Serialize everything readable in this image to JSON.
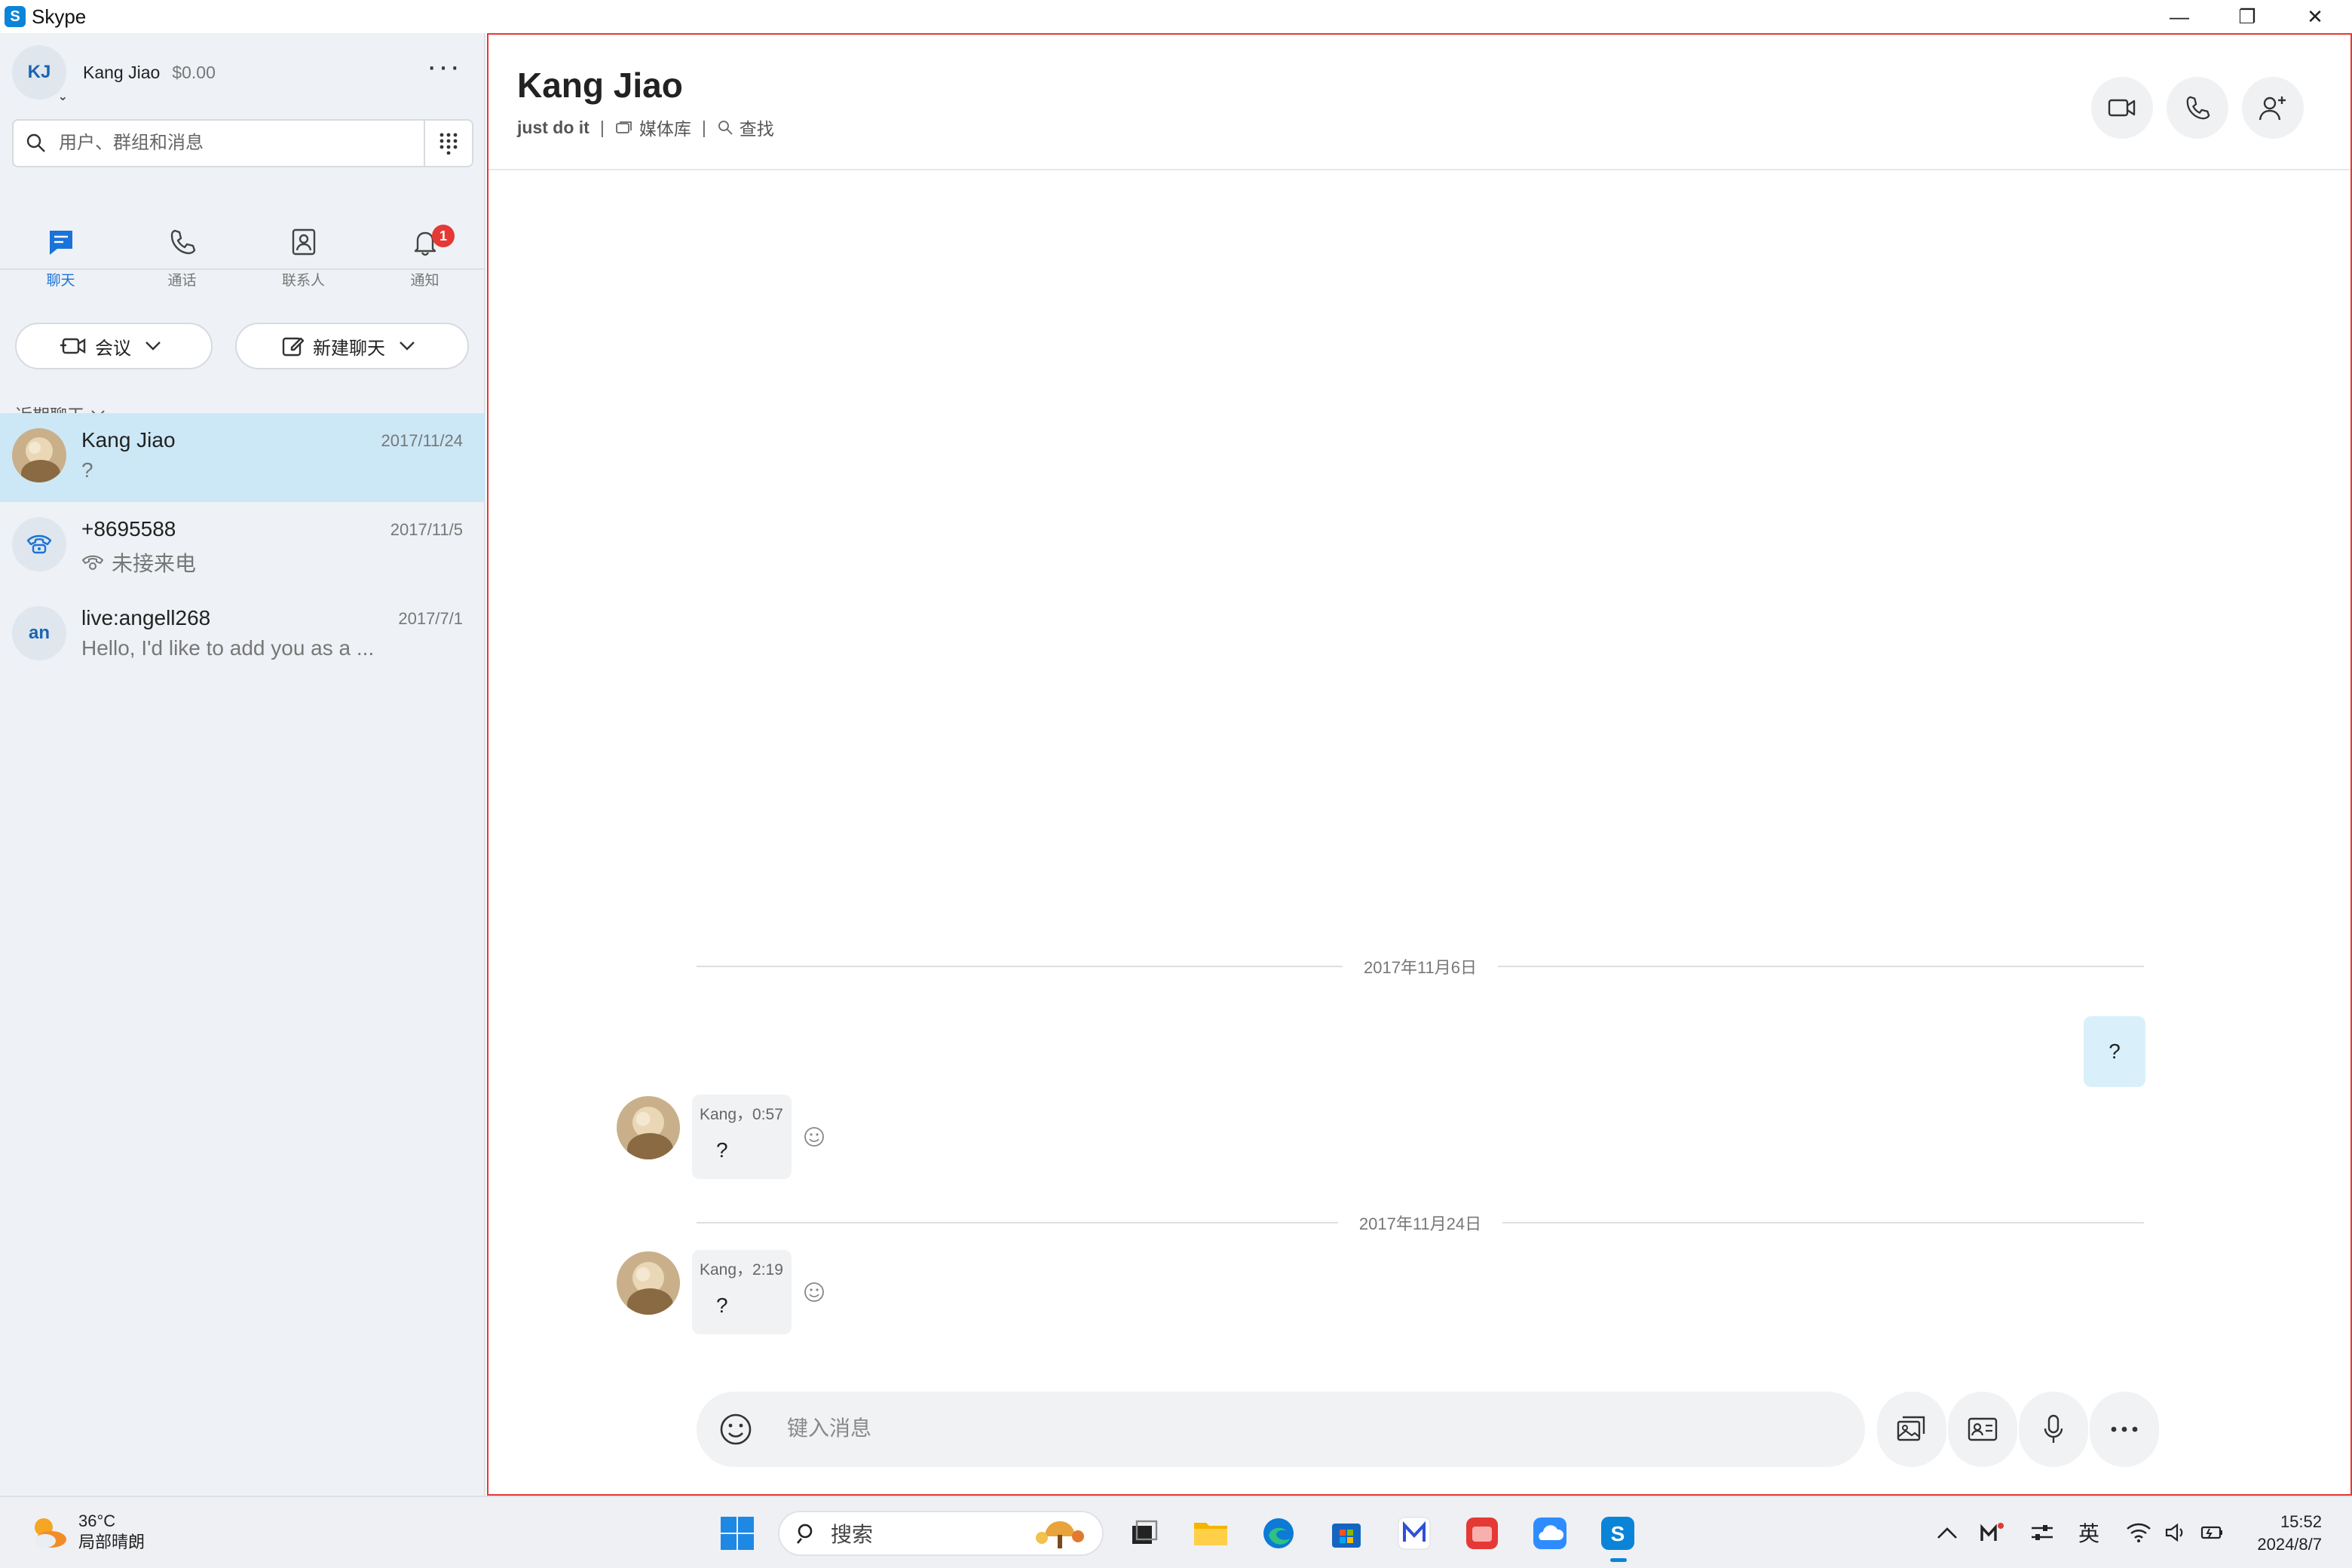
{
  "window": {
    "title": "Skype",
    "minimize_glyph": "—",
    "restore_glyph": "❐",
    "close_glyph": "✕"
  },
  "profile": {
    "initials": "KJ",
    "name": "Kang Jiao",
    "credit": "$0.00"
  },
  "search": {
    "placeholder": "用户、群组和消息"
  },
  "nav": {
    "tabs": [
      {
        "label": "聊天",
        "icon": "chat-icon",
        "active": true
      },
      {
        "label": "通话",
        "icon": "phone-icon"
      },
      {
        "label": "联系人",
        "icon": "contacts-icon"
      },
      {
        "label": "通知",
        "icon": "bell-icon",
        "badge": "1"
      }
    ]
  },
  "actions": {
    "meet_label": "会议",
    "new_chat_label": "新建聊天"
  },
  "recent": {
    "header": "近期聊天"
  },
  "conversations": [
    {
      "name": "Kang Jiao",
      "date": "2017/11/24",
      "preview": "?"
    },
    {
      "name": "+8695588",
      "date": "2017/11/5",
      "preview": "未接来电"
    },
    {
      "name": "live:angell268",
      "date": "2017/7/1",
      "preview": "Hello, I'd like to add you as a ...",
      "initials": "an"
    }
  ],
  "chat": {
    "title": "Kang Jiao",
    "mood": "just do it",
    "sep": "|",
    "media_label": "媒体库",
    "find_label": "查找",
    "date_1": "2017年11月6日",
    "date_2": "2017年11月24日",
    "own_message": "?",
    "messages": [
      {
        "meta": "Kang，0:57",
        "text": "?"
      },
      {
        "meta": "Kang，2:19",
        "text": "?"
      }
    ],
    "composer_placeholder": "键入消息"
  },
  "taskbar": {
    "weather_temp": "36°C",
    "weather_cond": "局部晴朗",
    "search_label": "搜索",
    "ime": "英",
    "time": "15:52",
    "date": "2024/8/7"
  },
  "colors": {
    "accent": "#1a73d9",
    "selected_row": "#cce8f7",
    "badge": "#e53935",
    "sidebar_bg": "#eef1f5"
  }
}
